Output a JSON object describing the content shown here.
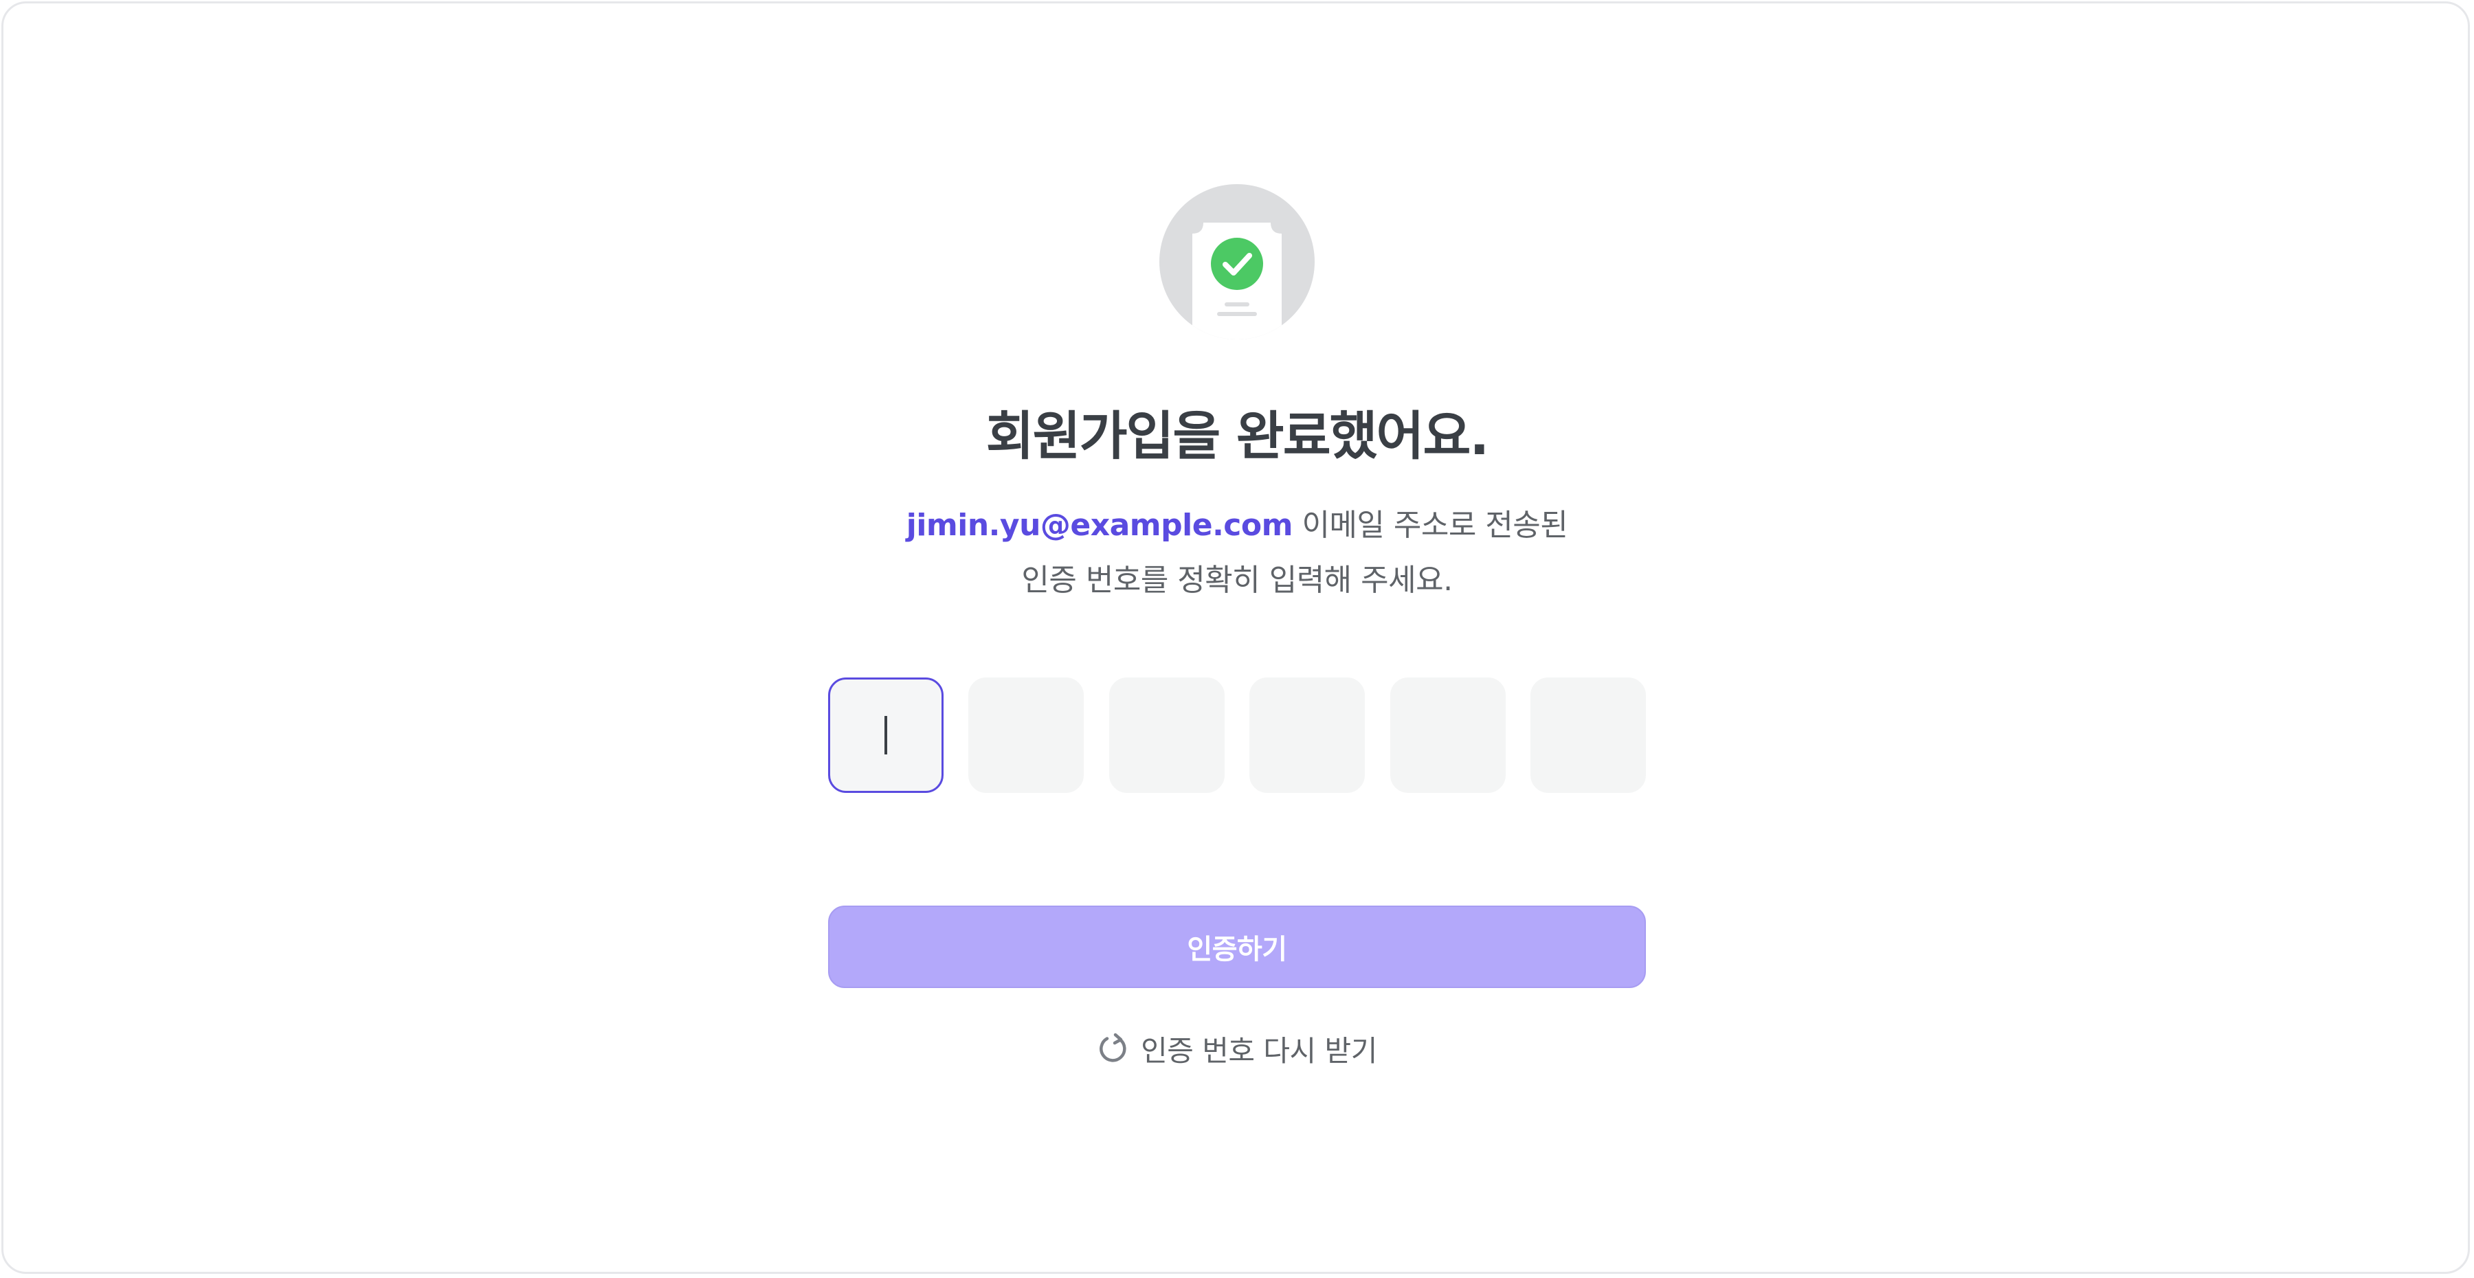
{
  "title": "회원가입을 완료했어요.",
  "description": {
    "email": "jimin.yu@example.com",
    "line1_suffix": " 이메일 주소로 전송된",
    "line2": "인증 번호를 정확히 입력해 주세요."
  },
  "otp": {
    "digits": [
      "",
      "",
      "",
      "",
      "",
      ""
    ],
    "active_index": 0
  },
  "verify_button": {
    "label": "인증하기"
  },
  "resend": {
    "label": "인증 번호 다시 받기",
    "icon": "refresh-icon"
  },
  "hero": {
    "icon": "document-check-icon"
  },
  "colors": {
    "accent": "#5a4be0",
    "button_bg": "#b3a8fa",
    "check_green": "#4cc964",
    "text_dark": "#3a3f45",
    "text_muted": "#5f6368",
    "input_bg": "#f4f5f5"
  }
}
